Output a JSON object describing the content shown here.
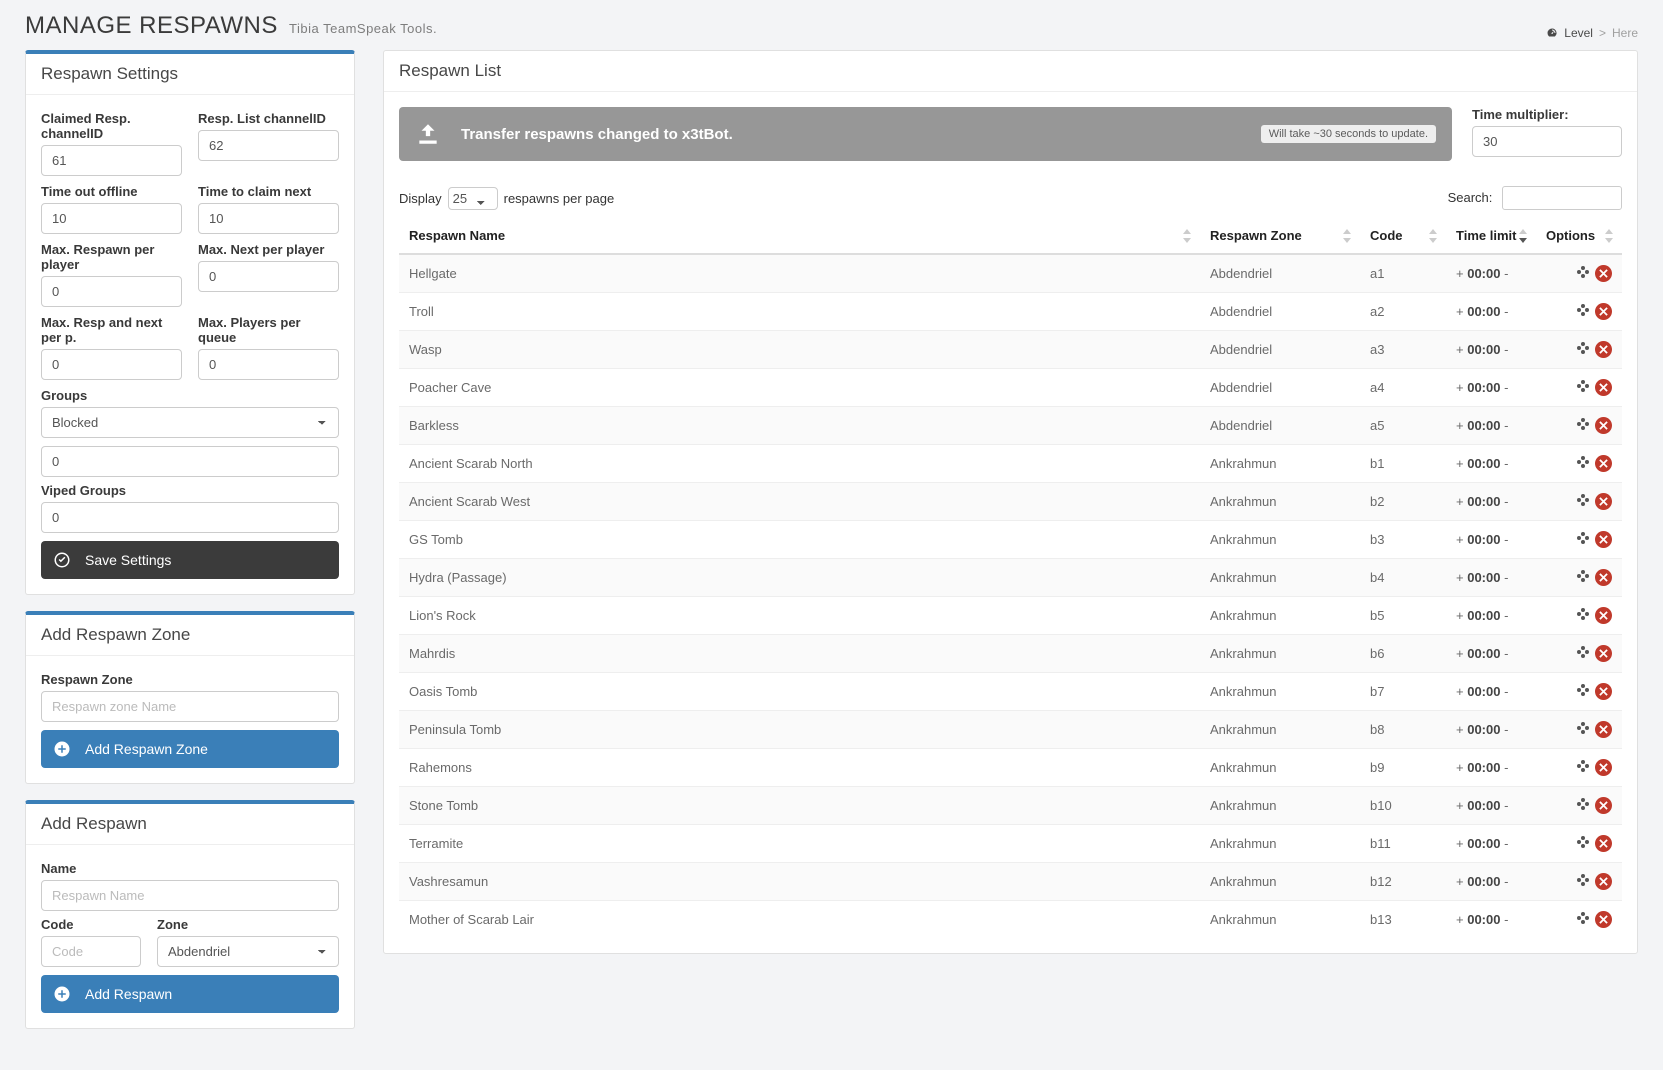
{
  "header": {
    "title": "MANAGE RESPAWNS",
    "subtitle": "Tibia TeamSpeak Tools.",
    "breadcrumb_level": "Level",
    "breadcrumb_sep": ">",
    "breadcrumb_here": "Here"
  },
  "settings": {
    "panel_title": "Respawn Settings",
    "claimed_label": "Claimed Resp. channelID",
    "claimed_value": "61",
    "list_label": "Resp. List channelID",
    "list_value": "62",
    "timeout_label": "Time out offline",
    "timeout_value": "10",
    "claimnext_label": "Time to claim next",
    "claimnext_value": "10",
    "maxresp_label": "Max. Respawn per player",
    "maxresp_value": "0",
    "maxnext_label": "Max. Next per player",
    "maxnext_value": "0",
    "maxrn_label": "Max. Resp and next per p.",
    "maxrn_value": "0",
    "maxq_label": "Max. Players per queue",
    "maxq_value": "0",
    "groups_label": "Groups",
    "groups_select": "Blocked",
    "groups_value": "0",
    "vip_label": "Viped Groups",
    "vip_value": "0",
    "save_btn": "Save Settings"
  },
  "addzone": {
    "panel_title": "Add Respawn Zone",
    "label": "Respawn Zone",
    "placeholder": "Respawn zone Name",
    "btn": "Add Respawn Zone"
  },
  "addrespawn": {
    "panel_title": "Add Respawn",
    "name_label": "Name",
    "name_placeholder": "Respawn Name",
    "code_label": "Code",
    "code_placeholder": "Code",
    "zone_label": "Zone",
    "zone_selected": "Abdendriel",
    "btn": "Add Respawn"
  },
  "list": {
    "panel_title": "Respawn List",
    "alert_text": "Transfer respawns changed to x3tBot.",
    "alert_chip": "Will take ~30 seconds to update.",
    "mult_label": "Time multiplier:",
    "mult_value": "30",
    "display_label": "Display",
    "display_select": "25",
    "display_suffix": "respawns per page",
    "search_label": "Search:",
    "col_name": "Respawn Name",
    "col_zone": "Respawn Zone",
    "col_code": "Code",
    "col_tl": "Time limit",
    "col_opts": "Options",
    "tl_plus": "+",
    "tl_minus": "-",
    "rows": [
      {
        "name": "Hellgate",
        "zone": "Abdendriel",
        "code": "a1",
        "tl": "00:00"
      },
      {
        "name": "Troll",
        "zone": "Abdendriel",
        "code": "a2",
        "tl": "00:00"
      },
      {
        "name": "Wasp",
        "zone": "Abdendriel",
        "code": "a3",
        "tl": "00:00"
      },
      {
        "name": "Poacher Cave",
        "zone": "Abdendriel",
        "code": "a4",
        "tl": "00:00"
      },
      {
        "name": "Barkless",
        "zone": "Abdendriel",
        "code": "a5",
        "tl": "00:00"
      },
      {
        "name": "Ancient Scarab North",
        "zone": "Ankrahmun",
        "code": "b1",
        "tl": "00:00"
      },
      {
        "name": "Ancient Scarab West",
        "zone": "Ankrahmun",
        "code": "b2",
        "tl": "00:00"
      },
      {
        "name": "GS Tomb",
        "zone": "Ankrahmun",
        "code": "b3",
        "tl": "00:00"
      },
      {
        "name": "Hydra (Passage)",
        "zone": "Ankrahmun",
        "code": "b4",
        "tl": "00:00"
      },
      {
        "name": "Lion's Rock",
        "zone": "Ankrahmun",
        "code": "b5",
        "tl": "00:00"
      },
      {
        "name": "Mahrdis",
        "zone": "Ankrahmun",
        "code": "b6",
        "tl": "00:00"
      },
      {
        "name": "Oasis Tomb",
        "zone": "Ankrahmun",
        "code": "b7",
        "tl": "00:00"
      },
      {
        "name": "Peninsula Tomb",
        "zone": "Ankrahmun",
        "code": "b8",
        "tl": "00:00"
      },
      {
        "name": "Rahemons",
        "zone": "Ankrahmun",
        "code": "b9",
        "tl": "00:00"
      },
      {
        "name": "Stone Tomb",
        "zone": "Ankrahmun",
        "code": "b10",
        "tl": "00:00"
      },
      {
        "name": "Terramite",
        "zone": "Ankrahmun",
        "code": "b11",
        "tl": "00:00"
      },
      {
        "name": "Vashresamun",
        "zone": "Ankrahmun",
        "code": "b12",
        "tl": "00:00"
      },
      {
        "name": "Mother of Scarab Lair",
        "zone": "Ankrahmun",
        "code": "b13",
        "tl": "00:00"
      }
    ]
  }
}
